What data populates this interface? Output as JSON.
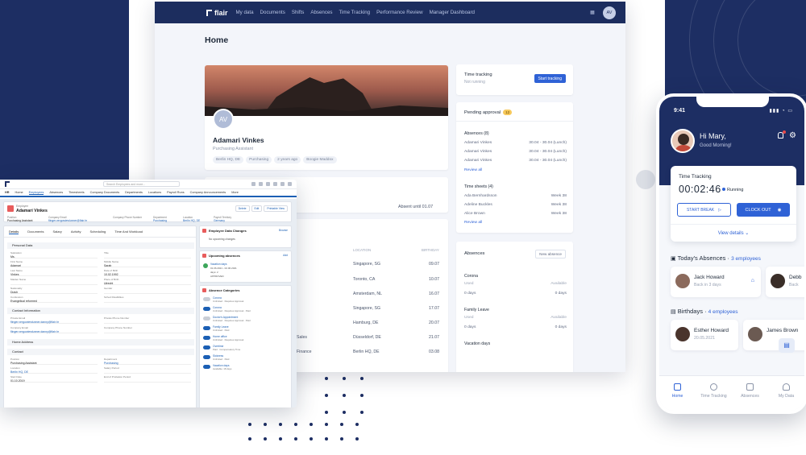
{
  "desktop": {
    "brand": "flair",
    "nav": [
      "My data",
      "Documents",
      "Shifts",
      "Absences",
      "Time Tracking",
      "Performance Review",
      "Manager Dashboard"
    ],
    "avatar": "AV",
    "page_title": "Home",
    "profile": {
      "initials": "AV",
      "name": "Adamari Vinkes",
      "role": "Purchasing Assistant",
      "tags": [
        "Berlin HQ, DE",
        "Purchasing",
        "2 years ago",
        "Boogie Maddox"
      ]
    },
    "absent_until": "Absent until 01.07",
    "table": {
      "headers": [
        "LOCATION",
        "BIRTHDAY"
      ],
      "rows": [
        {
          "dept": "",
          "location": "Singapore, SG",
          "birthday": "09.07"
        },
        {
          "dept": "",
          "location": "Toronto, CA",
          "birthday": "10.07"
        },
        {
          "dept": "",
          "location": "Amsterdam, NL",
          "birthday": "16.07"
        },
        {
          "dept": "",
          "location": "Singapore, SG",
          "birthday": "17.07"
        },
        {
          "dept": "",
          "location": "Hamburg, DE",
          "birthday": "20.07"
        },
        {
          "dept": "Sales",
          "location": "Düsseldorf, DE",
          "birthday": "21.07"
        },
        {
          "dept": "Finance",
          "location": "Berlin HQ, DE",
          "birthday": "03.08"
        }
      ]
    },
    "time_tracking": {
      "title": "Time tracking",
      "status": "Not running",
      "button": "Start tracking"
    },
    "pending": {
      "title": "Pending approval",
      "count": "12",
      "absences_title": "Absences (8)",
      "absences": [
        {
          "name": "Adamari Vinkes",
          "date": "30.04 - 30.04 (Lunch)"
        },
        {
          "name": "Adamari Vinkes",
          "date": "30.04 - 30.04 (Lunch)"
        },
        {
          "name": "Adamari Vinkes",
          "date": "30.04 - 30.04 (Lunch)"
        }
      ],
      "review": "Review all",
      "timesheets_title": "Time sheets (4)",
      "timesheets": [
        {
          "name": "Ada Bernhardsson",
          "week": "Week 38"
        },
        {
          "name": "Adeline Buckles",
          "week": "Week 38"
        },
        {
          "name": "Alice Brown",
          "week": "Week 38"
        }
      ]
    },
    "absences": {
      "title": "Absences",
      "new": "New absence",
      "groups": [
        {
          "name": "Corona",
          "used_label": "Used",
          "avail_label": "Available",
          "used": "0 days",
          "avail": "0 days"
        },
        {
          "name": "Family Leave",
          "used_label": "Used",
          "avail_label": "Available",
          "used": "0 days",
          "avail": "0 days"
        },
        {
          "name": "Vacation days",
          "used_label": "",
          "avail_label": "",
          "used": "",
          "avail": ""
        }
      ]
    }
  },
  "salesforce": {
    "search": "Search Employees and more...",
    "tabs": [
      "HR",
      "Home",
      "Employees",
      "Absences",
      "Timesheets",
      "Company Documents",
      "Departments",
      "Locations",
      "Payroll Runs",
      "Company Announcements",
      "More"
    ],
    "record_type": "Employee",
    "record_name": "Adamari Vinkes",
    "buttons": [
      "Delete",
      "Edit",
      "Printable View"
    ],
    "head_fields": [
      {
        "label": "Position",
        "value": "Purchasing Assistant"
      },
      {
        "label": "Company Email",
        "value": "flinger.vergowiewlunner@flair.hr"
      },
      {
        "label": "Company Phone Number",
        "value": ""
      },
      {
        "label": "Department",
        "value": "Purchasing"
      },
      {
        "label": "Location",
        "value": "Berlin HQ, DE"
      },
      {
        "label": "Payroll Territory",
        "value": "Germany"
      }
    ],
    "subtabs": [
      "Details",
      "Documents",
      "Salary",
      "Activity",
      "Scheduling",
      "Time And Workload"
    ],
    "sections": [
      "Personal Data",
      "Contact Information",
      "Home Address",
      "Contact"
    ],
    "personal": [
      {
        "label": "Salutation",
        "value": "Ms."
      },
      {
        "label": "Title",
        "value": ""
      },
      {
        "label": "First Name",
        "value": "Adamari"
      },
      {
        "label": "Middle Name",
        "value": "Sarah"
      },
      {
        "label": "Last Name",
        "value": "Vinkes"
      },
      {
        "label": "Date of Birth",
        "value": "10.02.1992"
      },
      {
        "label": "Maiden Name",
        "value": ""
      },
      {
        "label": "Place of Birth",
        "value": "Utrecht"
      },
      {
        "label": "Nationality",
        "value": "Dutch"
      },
      {
        "label": "Gender",
        "value": ""
      },
      {
        "label": "Confession",
        "value": "Evangelical reformed"
      },
      {
        "label": "Sched Disabilities",
        "value": ""
      }
    ],
    "contact_info": [
      {
        "label": "Private Email",
        "value": "flinger.vergowiewlunner.danny@flair.hr"
      },
      {
        "label": "Private Phone Number",
        "value": ""
      },
      {
        "label": "Company Email",
        "value": "flinger.vergowiewlunner.danny@flair.hr"
      },
      {
        "label": "Company Phone Number",
        "value": ""
      }
    ],
    "contact": [
      {
        "label": "Position",
        "value": "Purchasing Assistant"
      },
      {
        "label": "Department",
        "value": "Purchasing"
      },
      {
        "label": "Location",
        "value": "Berlin HQ, DE"
      },
      {
        "label": "Salary Period",
        "value": ""
      },
      {
        "label": "Start Date",
        "value": "01.10.2019"
      },
      {
        "label": "End of Probation Period",
        "value": ""
      }
    ],
    "changes": {
      "title": "Employee Data Changes",
      "action": "Browse",
      "empty": "No upcoming changes"
    },
    "upcoming": {
      "title": "Upcoming absences",
      "action": "Add",
      "item": "Vacation days",
      "range": "01.06.2021 - 02.06.2021",
      "days": "days: 2",
      "status": "APPROVED"
    },
    "categories": {
      "title": "Absence Categories",
      "items": [
        {
          "name": "Corona",
          "desc": "Unlimited · Requires Approval",
          "on": false
        },
        {
          "name": "Corona",
          "desc": "Unlimited · Requires Approval · Paid",
          "on": true
        },
        {
          "name": "Doctor's Appointment",
          "desc": "Unlimited · Requires Approval · Paid",
          "on": false
        },
        {
          "name": "Family Leave",
          "desc": "Unlimited · Paid",
          "on": true
        },
        {
          "name": "Home office",
          "desc": "Unlimited · Requires Approval",
          "on": true
        },
        {
          "name": "Overtime",
          "desc": "Paid · Compensatory Time",
          "on": true
        },
        {
          "name": "Sickness",
          "desc": "Unlimited · Paid",
          "on": true
        },
        {
          "name": "Vacation days",
          "desc": "Available: 18 days",
          "on": true
        }
      ]
    }
  },
  "phone": {
    "time": "9:41",
    "greeting": "Hi Mary,",
    "sub": "Good Morning!",
    "tracking": {
      "title": "Time Tracking",
      "clock": "00:02:46",
      "status": "Running",
      "break": "START BREAK",
      "clockout": "CLOCK OUT",
      "details": "View details"
    },
    "absences_title": "Today's Absences",
    "absences_count": "3 employees",
    "absences": [
      {
        "name": "Jack Howard",
        "sub": "Back in 3 days"
      },
      {
        "name": "Debb",
        "sub": "Back"
      }
    ],
    "birthdays_title": "Birthdays",
    "birthdays_count": "4 employees",
    "birthdays": [
      {
        "name": "Esther Howard",
        "sub": "20.05.2021"
      },
      {
        "name": "James Brown",
        "sub": ""
      }
    ],
    "tabs": [
      "Home",
      "Time Tracking",
      "Absences",
      "My Data"
    ]
  }
}
